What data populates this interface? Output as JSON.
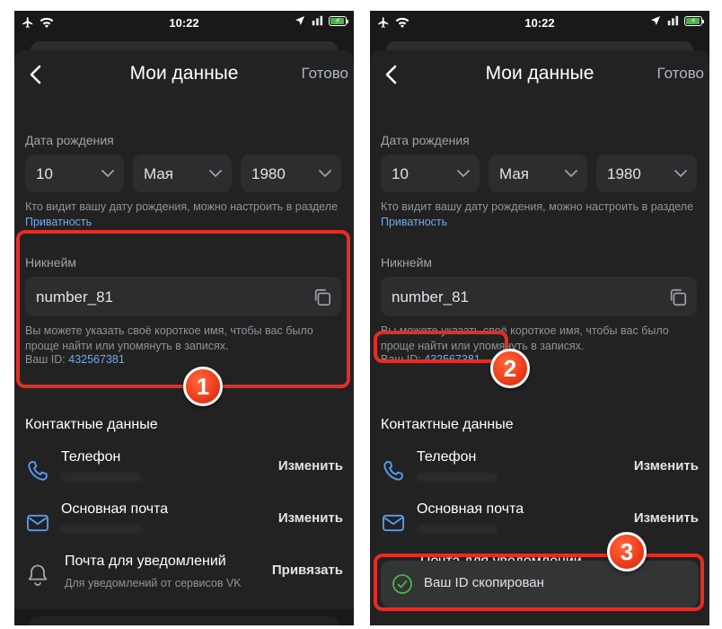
{
  "status_bar": {
    "time": "10:22"
  },
  "nav": {
    "title": "Мои данные",
    "done_label": "Готово"
  },
  "birthdate": {
    "label": "Дата рождения",
    "day": "10",
    "month": "Мая",
    "year": "1980",
    "hint_text": "Кто видит вашу дату рождения, можно настроить в разделе",
    "hint_link": "Приватность"
  },
  "nickname": {
    "label": "Никнейм",
    "value": "number_81",
    "hint": "Вы можете указать своё короткое имя, чтобы вас было проще найти или упомянуть в записях.",
    "id_label": "Ваш ID:",
    "id_value": "432567381"
  },
  "contacts": {
    "title": "Контактные данные",
    "items": [
      {
        "title": "Телефон",
        "action": "Изменить",
        "icon": "phone-icon"
      },
      {
        "title": "Основная почта",
        "action": "Изменить",
        "icon": "mail-icon"
      },
      {
        "title": "Почта для уведомлений",
        "subtitle": "Для уведомлений от сервисов VK",
        "action": "Привязать",
        "icon": "bell-icon"
      }
    ]
  },
  "toast": {
    "text": "Ваш ID скопирован",
    "icon": "check-circle-icon"
  },
  "annotations": {
    "step1": "1",
    "step2": "2",
    "step3": "3"
  },
  "colors": {
    "accent_link": "#71aaeb",
    "highlight": "#e62d22",
    "badge": "#ee3a1a",
    "toast_check": "#4bb34b"
  }
}
